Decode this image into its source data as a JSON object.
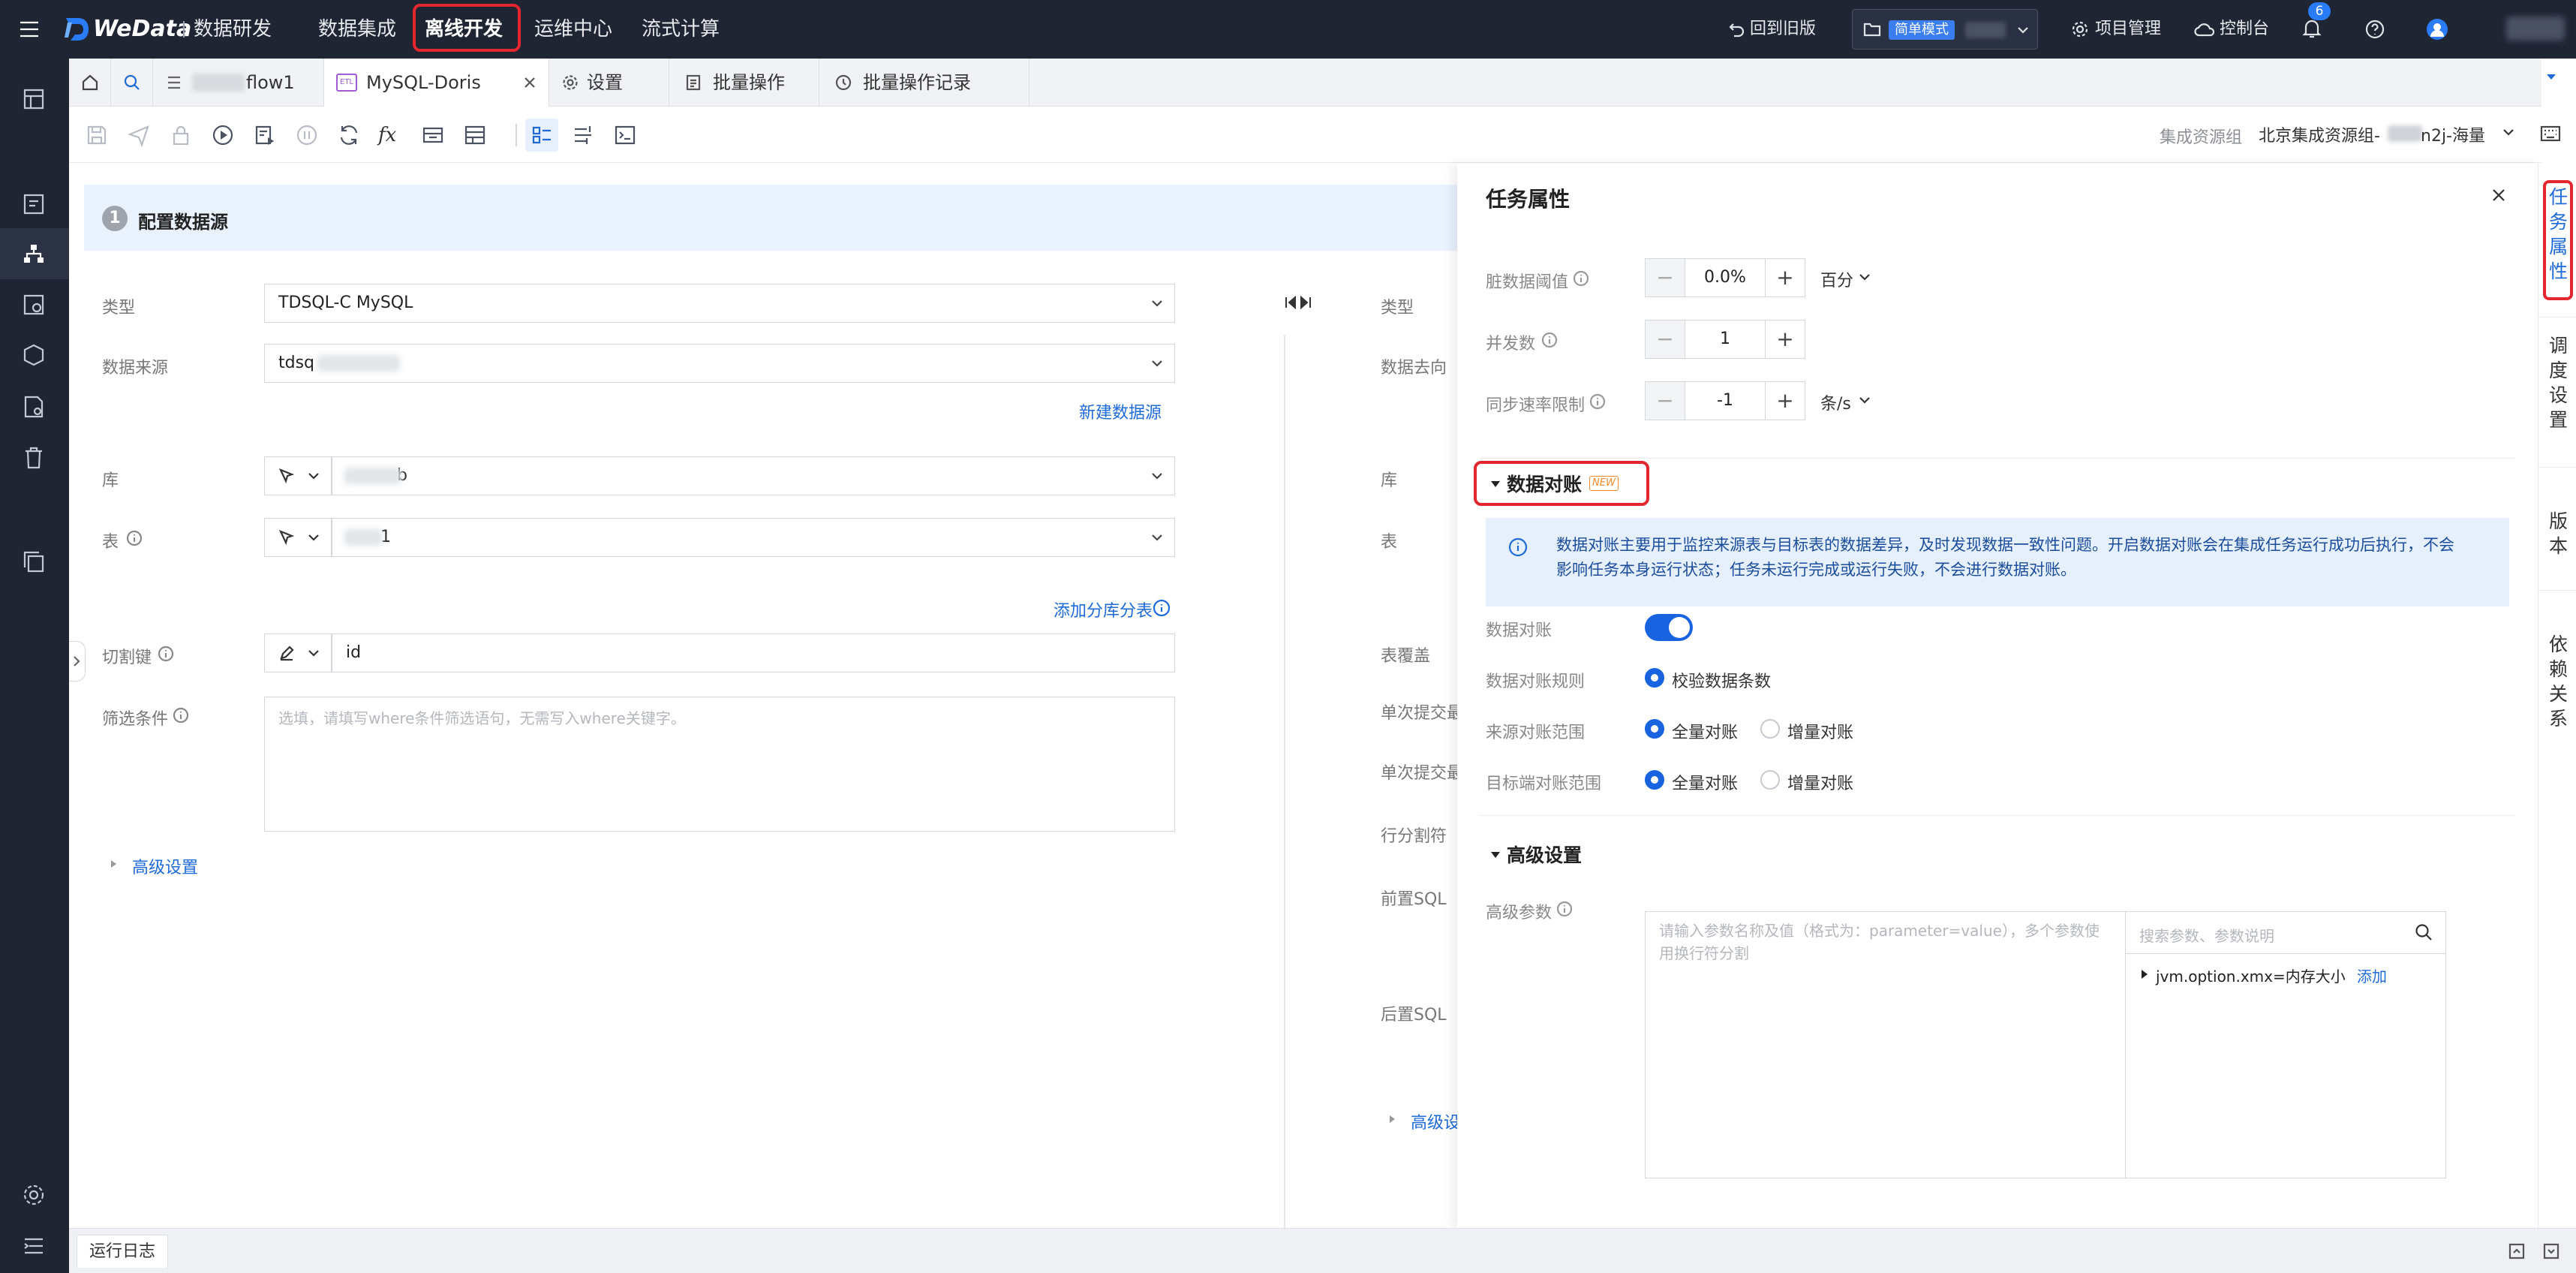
{
  "brand": {
    "logo_text": "WeData",
    "module": "数据研发"
  },
  "topnav": {
    "items": [
      "数据集成",
      "离线开发",
      "运维中心",
      "流式计算"
    ],
    "back_old": "回到旧版",
    "mode_badge": "简单模式",
    "project_mgmt": "项目管理",
    "console": "控制台",
    "notif_count": "6"
  },
  "tabs": [
    {
      "label": "flow1"
    },
    {
      "label": "MySQL-Doris",
      "badge": "ETL"
    },
    {
      "label": "设置"
    },
    {
      "label": "批量操作"
    },
    {
      "label": "批量操作记录"
    }
  ],
  "toolbar": {
    "resource_group_label": "集成资源组",
    "resource_group_value": "北京集成资源组-",
    "resource_group_suffix": "n2j-海量"
  },
  "source": {
    "step_number": "1",
    "step_title": "配置数据源",
    "type_label": "类型",
    "type_value": "TDSQL-C MySQL",
    "datasource_label": "数据来源",
    "datasource_value": "tdsq",
    "new_datasource": "新建数据源",
    "db_label": "库",
    "db_value": "b",
    "table_label": "表",
    "table_value": "1",
    "add_shard": "添加分库分表",
    "split_label": "切割键",
    "split_value": "id",
    "filter_label": "筛选条件",
    "filter_placeholder": "选填，请填写where条件筛选语句，无需写入where关键字。",
    "advanced": "高级设置"
  },
  "target": {
    "type_label": "类型",
    "direction_label": "数据去向",
    "db_label": "库",
    "table_label": "表",
    "overwrite_label": "表覆盖",
    "batch1_label": "单次提交最",
    "batch2_label": "单次提交最",
    "row_sep_label": "行分割符",
    "pre_sql_label": "前置SQL",
    "post_sql_label": "后置SQL",
    "advanced": "高级设"
  },
  "panel": {
    "title": "任务属性",
    "dirty_label": "脏数据阈值",
    "dirty_value": "0.0%",
    "dirty_unit": "百分",
    "concurrency_label": "并发数",
    "concurrency_value": "1",
    "rate_label": "同步速率限制",
    "rate_value": "-1",
    "rate_unit": "条/s",
    "recon_section": "数据对账",
    "recon_new_badge": "NEW",
    "recon_info": "数据对账主要用于监控来源表与目标表的数据差异，及时发现数据一致性问题。开启数据对账会在集成任务运行成功后执行，不会影响任务本身运行状态；任务未运行完成或运行失败，不会进行数据对账。",
    "recon_toggle_label": "数据对账",
    "recon_rule_label": "数据对账规则",
    "recon_rule_option": "校验数据条数",
    "src_range_label": "来源对账范围",
    "src_range_full": "全量对账",
    "src_range_incr": "增量对账",
    "dst_range_label": "目标端对账范围",
    "dst_range_full": "全量对账",
    "dst_range_incr": "增量对账",
    "adv_section": "高级设置",
    "adv_params_label": "高级参数",
    "adv_params_placeholder": "请输入参数名称及值（格式为：parameter=value），多个参数使用换行符分割",
    "param_search_placeholder": "搜索参数、参数说明",
    "param_item": "jvm.option.xmx=内存大小",
    "param_add": "添加"
  },
  "rail": {
    "items": [
      "任务属性",
      "调度设置",
      "版本",
      "依赖关系"
    ]
  },
  "footer": {
    "log_label": "运行日志"
  },
  "colors": {
    "accent": "#1864e0",
    "highlight": "#e4262f",
    "nav_bg": "#1f2533",
    "info_bg": "#e6f0fd"
  }
}
